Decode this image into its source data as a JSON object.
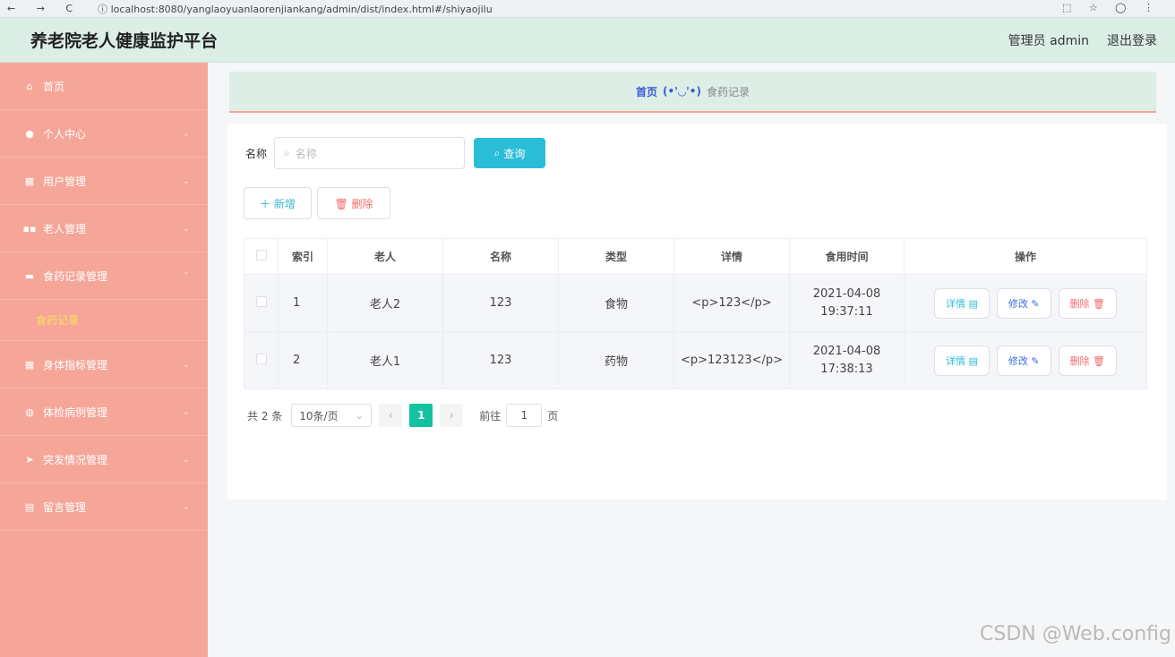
{
  "browser": {
    "nav_glyphs": "← → C",
    "url": "ⓘ localhost:8080/yanglaoyuanlaorenjiankang/admin/dist/index.html#/shiyaojilu",
    "right_glyphs": "⬚ ☆ ◯ ⋮"
  },
  "header": {
    "title": "养老院老人健康监护平台",
    "user_label": "管理员 admin",
    "logout_label": "退出登录"
  },
  "sidebar": {
    "items": [
      {
        "label": "首页",
        "icon": "home-icon",
        "glyph": "⌂",
        "chevron": ""
      },
      {
        "label": "个人中心",
        "icon": "user-icon",
        "glyph": "●",
        "chevron": "⌄"
      },
      {
        "label": "用户管理",
        "icon": "clipboard-icon",
        "glyph": "▦",
        "chevron": "⌄"
      },
      {
        "label": "老人管理",
        "icon": "grid-icon",
        "glyph": "▪▪",
        "chevron": "⌄"
      },
      {
        "label": "食药记录管理",
        "icon": "briefcase-icon",
        "glyph": "▬",
        "chevron": "⌃"
      },
      {
        "label": "身体指标管理",
        "icon": "grid-icon",
        "glyph": "▦",
        "chevron": "⌄"
      },
      {
        "label": "体检病例管理",
        "icon": "compass-icon",
        "glyph": "◍",
        "chevron": "⌄"
      },
      {
        "label": "突发情况管理",
        "icon": "send-icon",
        "glyph": "➤",
        "chevron": "⌄"
      },
      {
        "label": "留言管理",
        "icon": "document-icon",
        "glyph": "▤",
        "chevron": "⌄"
      }
    ],
    "sub_item": "食药记录"
  },
  "breadcrumb": {
    "home": "首页",
    "face": "(•'◡'•)",
    "current": "食药记录"
  },
  "search": {
    "label": "名称",
    "placeholder": "名称",
    "query_label": "查询"
  },
  "actions": {
    "add_label": "＋ 新增",
    "delete_label": "🗑 删除"
  },
  "table": {
    "columns": [
      "索引",
      "老人",
      "名称",
      "类型",
      "详情",
      "食用时间",
      "操作"
    ],
    "rows": [
      {
        "index": "1",
        "elder": "老人2",
        "name": "123",
        "type": "食物",
        "detail": "<p>123</p>",
        "time": "2021-04-08 19:37:11"
      },
      {
        "index": "2",
        "elder": "老人1",
        "name": "123",
        "type": "药物",
        "detail": "<p>123123</p>",
        "time": "2021-04-08 17:38:13"
      }
    ],
    "op_detail": "详情 ▤",
    "op_edit": "修改 ✎",
    "op_delete": "删除 🗑"
  },
  "pager": {
    "total": "共 2 条",
    "page_size": "10条/页",
    "prev": "‹",
    "current": "1",
    "next": "›",
    "goto": "前往",
    "goto_value": "1",
    "page_unit": "页"
  },
  "watermark": "CSDN @Web.config"
}
